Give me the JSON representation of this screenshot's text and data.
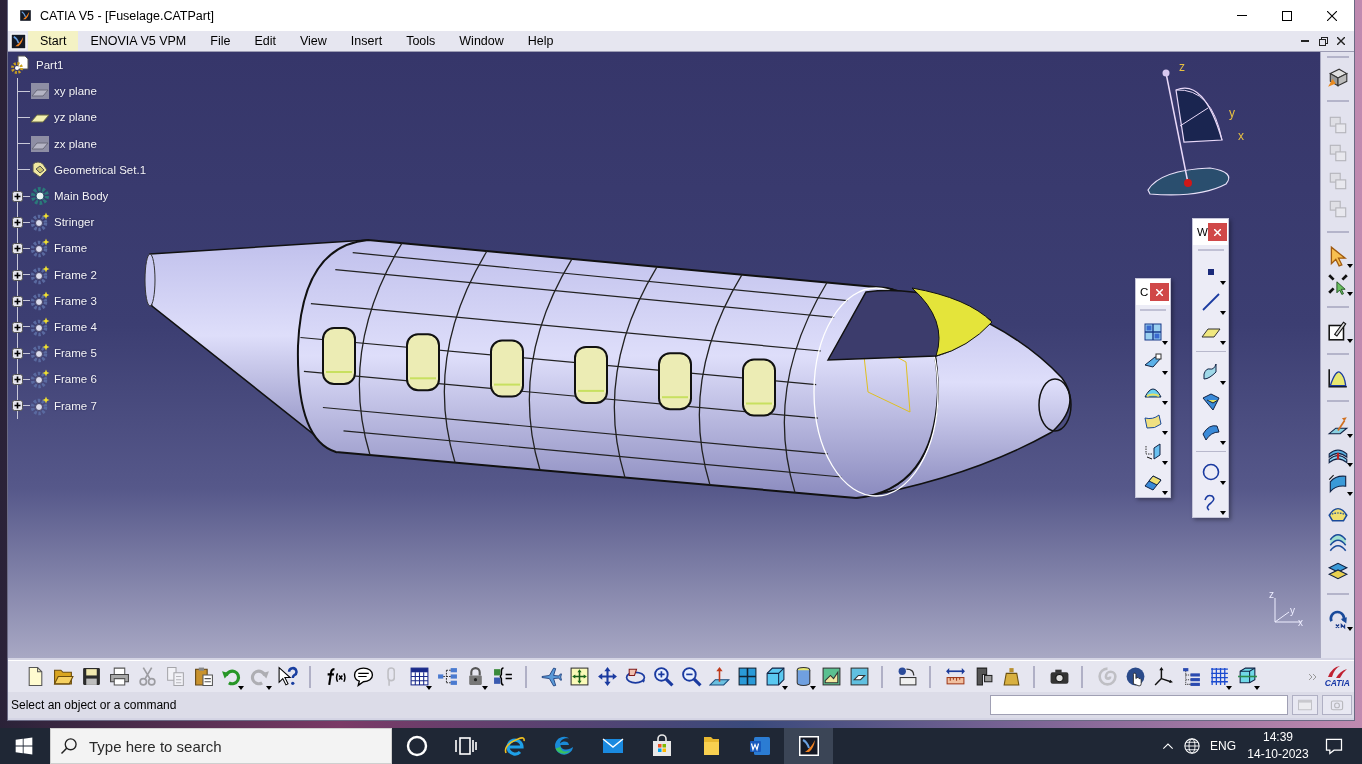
{
  "window": {
    "title": "CATIA V5 - [Fuselage.CATPart]"
  },
  "menu_bar": {
    "items": [
      {
        "label": "Start",
        "selected": true
      },
      {
        "label": "ENOVIA V5 VPM",
        "selected": false
      },
      {
        "label": "File",
        "selected": false
      },
      {
        "label": "Edit",
        "selected": false
      },
      {
        "label": "View",
        "selected": false
      },
      {
        "label": "Insert",
        "selected": false
      },
      {
        "label": "Tools",
        "selected": false
      },
      {
        "label": "Window",
        "selected": false
      },
      {
        "label": "Help",
        "selected": false
      }
    ]
  },
  "specification_tree": {
    "label": "Part1",
    "kind": "part",
    "children": [
      {
        "label": "xy plane",
        "kind": "plane",
        "hidden": true
      },
      {
        "label": "yz plane",
        "kind": "plane",
        "hidden": false
      },
      {
        "label": "zx plane",
        "kind": "plane",
        "hidden": true
      },
      {
        "label": "Geometrical Set.1",
        "kind": "geometrical-set"
      },
      {
        "label": "Main Body",
        "kind": "part-body",
        "expanded": false
      },
      {
        "label": "Stringer",
        "kind": "body",
        "expanded": false
      },
      {
        "label": "Frame",
        "kind": "body",
        "expanded": false
      },
      {
        "label": "Frame 2",
        "kind": "body",
        "expanded": false
      },
      {
        "label": "Frame 3",
        "kind": "body",
        "expanded": false
      },
      {
        "label": "Frame 4",
        "kind": "body",
        "expanded": false
      },
      {
        "label": "Frame 5",
        "kind": "body",
        "expanded": false
      },
      {
        "label": "Frame 6",
        "kind": "body",
        "expanded": false
      },
      {
        "label": "Frame 7",
        "kind": "body",
        "expanded": false
      }
    ]
  },
  "compass": {
    "labels": [
      "z",
      "y",
      "x"
    ]
  },
  "floating_toolbars": [
    {
      "title": "C",
      "groups": [
        [
          {
            "kind": "quad-grid",
            "disabled": false
          },
          {
            "kind": "arrow-surface",
            "disabled": false
          },
          {
            "kind": "arch-surface",
            "disabled": false
          },
          {
            "kind": "curved-panel",
            "disabled": false
          },
          {
            "kind": "projection",
            "disabled": false
          },
          {
            "kind": "split-surface",
            "disabled": false
          }
        ]
      ]
    },
    {
      "title": "W",
      "groups": [
        [
          {
            "kind": "point",
            "disabled": false
          },
          {
            "kind": "line",
            "disabled": false
          },
          {
            "kind": "plane",
            "disabled": false
          }
        ],
        [
          {
            "kind": "wave-surface",
            "disabled": false
          },
          {
            "kind": "intersect-surface",
            "disabled": false
          },
          {
            "kind": "ribbon-surface",
            "disabled": false
          }
        ],
        [
          {
            "kind": "circle",
            "disabled": false
          },
          {
            "kind": "spline",
            "disabled": false
          }
        ]
      ]
    }
  ],
  "axis_triad": {
    "labels": [
      "z",
      "y",
      "x"
    ]
  },
  "workbench_toolbar": {
    "groups": [
      [
        {
          "kind": "workbench",
          "disabled": false
        }
      ],
      [
        {
          "kind": "cubes",
          "disabled": true
        },
        {
          "kind": "cubes",
          "disabled": true
        },
        {
          "kind": "cubes",
          "disabled": true
        },
        {
          "kind": "cubes",
          "disabled": true
        }
      ],
      [
        {
          "kind": "select",
          "disabled": false
        },
        {
          "kind": "smart-select",
          "disabled": false
        }
      ],
      [
        {
          "kind": "sketch",
          "disabled": false
        }
      ],
      [
        {
          "kind": "curve-graph",
          "disabled": false
        }
      ],
      [
        {
          "kind": "extrude",
          "disabled": false
        },
        {
          "kind": "offset",
          "disabled": false
        },
        {
          "kind": "sweep",
          "disabled": false
        },
        {
          "kind": "fill",
          "disabled": false
        },
        {
          "kind": "multi-section",
          "disabled": false
        },
        {
          "kind": "blend",
          "disabled": false
        }
      ],
      [
        {
          "kind": "repeat",
          "disabled": false
        }
      ]
    ]
  },
  "standard_toolbar": {
    "groups": [
      [
        {
          "kind": "new",
          "disabled": false
        },
        {
          "kind": "open",
          "disabled": false
        },
        {
          "kind": "save",
          "disabled": false
        },
        {
          "kind": "print",
          "disabled": false
        },
        {
          "kind": "cut",
          "disabled": true
        },
        {
          "kind": "copy",
          "disabled": true
        },
        {
          "kind": "paste",
          "disabled": false
        },
        {
          "kind": "undo",
          "disabled": false
        },
        {
          "kind": "redo",
          "disabled": true
        },
        {
          "kind": "help",
          "disabled": false
        }
      ],
      [
        {
          "kind": "formula",
          "disabled": false
        },
        {
          "kind": "comment",
          "disabled": false
        },
        {
          "kind": "clip",
          "disabled": true
        },
        {
          "kind": "table",
          "disabled": false
        },
        {
          "kind": "node-graph",
          "disabled": false
        },
        {
          "kind": "lock",
          "disabled": false
        },
        {
          "kind": "parameters",
          "disabled": false
        }
      ],
      [
        {
          "kind": "fly",
          "disabled": false
        },
        {
          "kind": "fit-all",
          "disabled": false
        },
        {
          "kind": "pan",
          "disabled": false
        },
        {
          "kind": "rotate",
          "disabled": false
        },
        {
          "kind": "zoom-in",
          "disabled": false
        },
        {
          "kind": "zoom-out",
          "disabled": false
        },
        {
          "kind": "normal-view",
          "disabled": false
        },
        {
          "kind": "multi-view",
          "disabled": false
        },
        {
          "kind": "iso-view",
          "disabled": false
        },
        {
          "kind": "shading",
          "disabled": false
        },
        {
          "kind": "hide-show",
          "disabled": false
        },
        {
          "kind": "swap-visible",
          "disabled": false
        }
      ],
      [
        {
          "kind": "update",
          "disabled": false
        }
      ],
      [
        {
          "kind": "measure",
          "disabled": false
        },
        {
          "kind": "measure-item",
          "disabled": false
        },
        {
          "kind": "weight",
          "disabled": false
        }
      ],
      [
        {
          "kind": "capture",
          "disabled": false
        }
      ],
      [
        {
          "kind": "swirl",
          "disabled": true
        },
        {
          "kind": "manipulate",
          "disabled": false
        },
        {
          "kind": "axis",
          "disabled": false
        },
        {
          "kind": "tree-view",
          "disabled": false
        },
        {
          "kind": "grid",
          "disabled": false
        },
        {
          "kind": "body-box",
          "disabled": false
        }
      ]
    ],
    "logo": "CATIA"
  },
  "status_bar": {
    "message": "Select an object or a command",
    "buttons": [
      {
        "kind": "window",
        "disabled": true
      },
      {
        "kind": "record",
        "disabled": true
      }
    ]
  },
  "taskbar": {
    "search": {
      "placeholder": "Type here to search"
    },
    "buttons": [
      {
        "kind": "cortana",
        "selected": false
      },
      {
        "kind": "task-view",
        "selected": false
      },
      {
        "kind": "ie",
        "selected": false
      },
      {
        "kind": "edge",
        "selected": false
      },
      {
        "kind": "mail",
        "selected": false
      },
      {
        "kind": "store",
        "selected": false
      },
      {
        "kind": "explorer",
        "selected": false
      },
      {
        "kind": "word",
        "selected": false
      },
      {
        "kind": "catia",
        "selected": true
      }
    ],
    "tray": {
      "language": "ENG",
      "time": "14:39",
      "date": "14-10-2023"
    }
  }
}
